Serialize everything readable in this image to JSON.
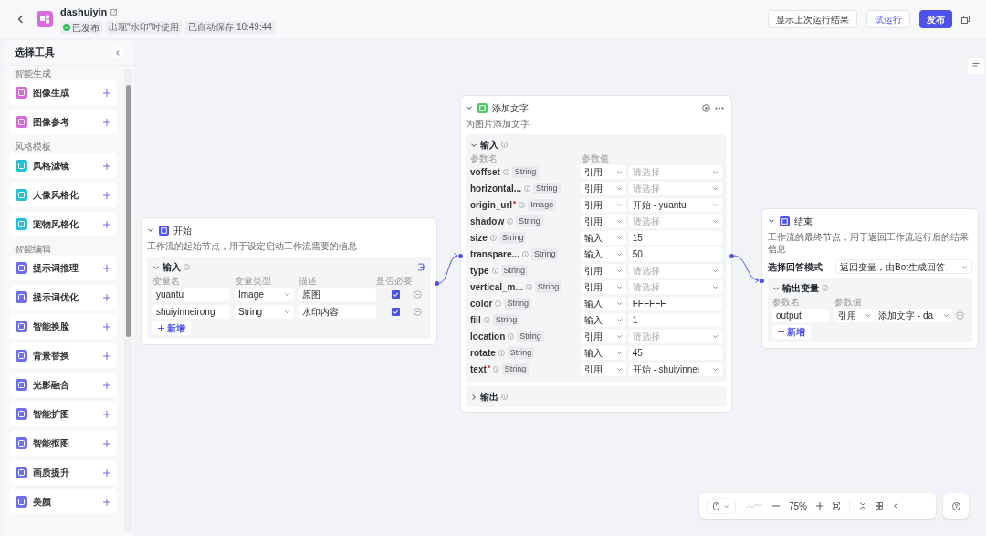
{
  "header": {
    "title": "dashuiyin",
    "status": "已发布",
    "published": true,
    "tags": [
      "出现\"水印\"时使用",
      "已自动保存 10:49:44"
    ],
    "buttons": [
      {
        "label": "显示上次运行结果",
        "kind": "plain"
      },
      {
        "label": "试运行",
        "kind": "outline"
      },
      {
        "label": "发布",
        "kind": "primary"
      }
    ]
  },
  "sidebar": {
    "title": "选择工具",
    "groups": [
      {
        "label": "智能生成",
        "color": "#d66ad8",
        "items": [
          "图像生成",
          "图像参考"
        ]
      },
      {
        "label": "风格模板",
        "color": "#27c1d3",
        "items": [
          "风格滤镜",
          "人像风格化",
          "宠物风格化"
        ]
      },
      {
        "label": "智能编辑",
        "color": "#6d70ea",
        "items": [
          "提示词推理",
          "提示词优化",
          "智能换脸",
          "背景替换",
          "光影融合",
          "智能扩图",
          "智能抠图",
          "画质提升",
          "美颜"
        ]
      }
    ]
  },
  "nodes": {
    "start": {
      "title": "开始",
      "description": "工作流的起始节点，用于设定启动工作流需要的信息",
      "section": {
        "title": "输入",
        "expanded": true
      },
      "columns": [
        "变量名",
        "变量类型",
        "描述",
        "是否必要"
      ],
      "rows": [
        {
          "name": "yuantu",
          "type": "Image",
          "description": "原图",
          "required": true
        },
        {
          "name": "shuiyinneirong",
          "type": "String",
          "description": "水印内容",
          "required": true
        }
      ],
      "add_label": "新增"
    },
    "add_text": {
      "title": "添加文字",
      "description": "为图片添加文字",
      "section": {
        "title": "输入",
        "expanded": true
      },
      "columns": [
        "参数名",
        "参数值"
      ],
      "params": [
        {
          "name": "voffset",
          "required": false,
          "type": "String",
          "mode": "引用",
          "kind": "select",
          "placeholder": "请选择"
        },
        {
          "name": "horizontal...",
          "required": false,
          "type": "String",
          "mode": "引用",
          "kind": "select",
          "placeholder": "请选择"
        },
        {
          "name": "origin_url",
          "required": true,
          "type": "Image",
          "mode": "引用",
          "kind": "select",
          "value": "开始 - yuantu"
        },
        {
          "name": "shadow",
          "required": false,
          "type": "String",
          "mode": "引用",
          "kind": "select",
          "placeholder": "请选择"
        },
        {
          "name": "size",
          "required": false,
          "type": "String",
          "mode": "输入",
          "kind": "text",
          "value": "15"
        },
        {
          "name": "transpare...",
          "required": false,
          "type": "String",
          "mode": "输入",
          "kind": "text",
          "value": "50"
        },
        {
          "name": "type",
          "required": false,
          "type": "String",
          "mode": "引用",
          "kind": "select",
          "placeholder": "请选择"
        },
        {
          "name": "vertical_m...",
          "required": false,
          "type": "String",
          "mode": "引用",
          "kind": "select",
          "placeholder": "请选择"
        },
        {
          "name": "color",
          "required": false,
          "type": "String",
          "mode": "输入",
          "kind": "text",
          "value": "FFFFFF"
        },
        {
          "name": "fill",
          "required": false,
          "type": "String",
          "mode": "输入",
          "kind": "text",
          "value": "1"
        },
        {
          "name": "location",
          "required": false,
          "type": "String",
          "mode": "引用",
          "kind": "select",
          "placeholder": "请选择"
        },
        {
          "name": "rotate",
          "required": false,
          "type": "String",
          "mode": "输入",
          "kind": "text",
          "value": "45"
        },
        {
          "name": "text",
          "required": true,
          "type": "String",
          "mode": "引用",
          "kind": "select",
          "value": "开始 - shuiyinnei"
        }
      ],
      "output_section": {
        "title": "输出",
        "expanded": false
      }
    },
    "end": {
      "title": "结束",
      "description": "工作流的最终节点，用于返回工作流运行后的结果信息",
      "mode_label": "选择回答模式",
      "mode_value": "返回变量，由Bot生成回答",
      "section": {
        "title": "输出变量",
        "expanded": true
      },
      "columns": [
        "参数名",
        "参数值"
      ],
      "rows": [
        {
          "name": "output",
          "mode": "引用",
          "value": "添加文字 - da"
        }
      ],
      "add_label": "新增"
    }
  },
  "toolbar": {
    "zoom": "75%"
  }
}
